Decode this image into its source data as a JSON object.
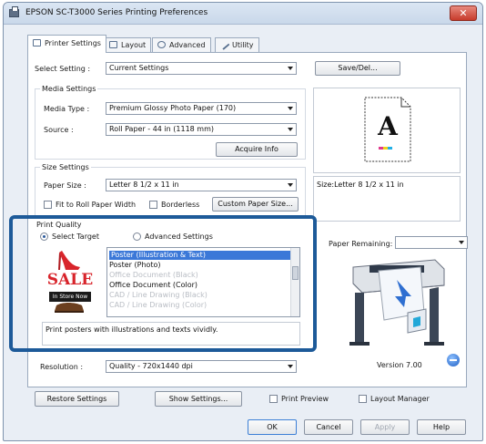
{
  "window": {
    "title": "EPSON SC-T3000 Series Printing Preferences"
  },
  "tabs": [
    {
      "label": "Printer Settings",
      "icon": "printer-icon"
    },
    {
      "label": "Layout",
      "icon": "layout-icon"
    },
    {
      "label": "Advanced",
      "icon": "advanced-icon"
    },
    {
      "label": "Utility",
      "icon": "utility-icon"
    }
  ],
  "select_setting": {
    "label": "Select Setting :",
    "value": "Current Settings",
    "save_button": "Save/Del..."
  },
  "media_settings": {
    "group_label": "Media Settings",
    "media_type_label": "Media Type :",
    "media_type_value": "Premium Glossy Photo Paper (170)",
    "source_label": "Source :",
    "source_value": "Roll Paper - 44 in (1118 mm)",
    "acquire_button": "Acquire Info"
  },
  "size_settings": {
    "group_label": "Size Settings",
    "paper_size_label": "Paper Size :",
    "paper_size_value": "Letter 8 1/2 x 11 in",
    "fit_roll_label": "Fit to Roll Paper Width",
    "borderless_label": "Borderless",
    "custom_button": "Custom Paper Size..."
  },
  "print_quality": {
    "group_label": "Print Quality",
    "select_target_label": "Select Target",
    "advanced_settings_label": "Advanced Settings",
    "targets": [
      {
        "label": "Poster (Illustration & Text)",
        "state": "selected"
      },
      {
        "label": "Poster (Photo)",
        "state": "normal"
      },
      {
        "label": "Office Document (Black)",
        "state": "dim"
      },
      {
        "label": "Office Document (Color)",
        "state": "normal"
      },
      {
        "label": "CAD / Line Drawing (Black)",
        "state": "dim"
      },
      {
        "label": "CAD / Line Drawing (Color)",
        "state": "dim"
      }
    ],
    "thumb_sale": "SALE",
    "thumb_banner": "In Store Now",
    "description": "Print posters with illustrations and texts vividly."
  },
  "resolution": {
    "label": "Resolution :",
    "value": "Quality - 720x1440 dpi"
  },
  "preview": {
    "letter": "A",
    "size_text": "Size:Letter 8 1/2 x 11 in",
    "paper_remaining_label": "Paper Remaining:",
    "version": "Version 7.00"
  },
  "bottom": {
    "restore_button": "Restore Settings",
    "show_settings_button": "Show Settings...",
    "print_preview_label": "Print Preview",
    "layout_manager_label": "Layout Manager"
  },
  "dialog": {
    "ok": "OK",
    "cancel": "Cancel",
    "apply": "Apply",
    "help": "Help"
  },
  "colors": {
    "highlight": "#1d5a99",
    "selection": "#3b78d8",
    "sale_red": "#d8242b"
  }
}
